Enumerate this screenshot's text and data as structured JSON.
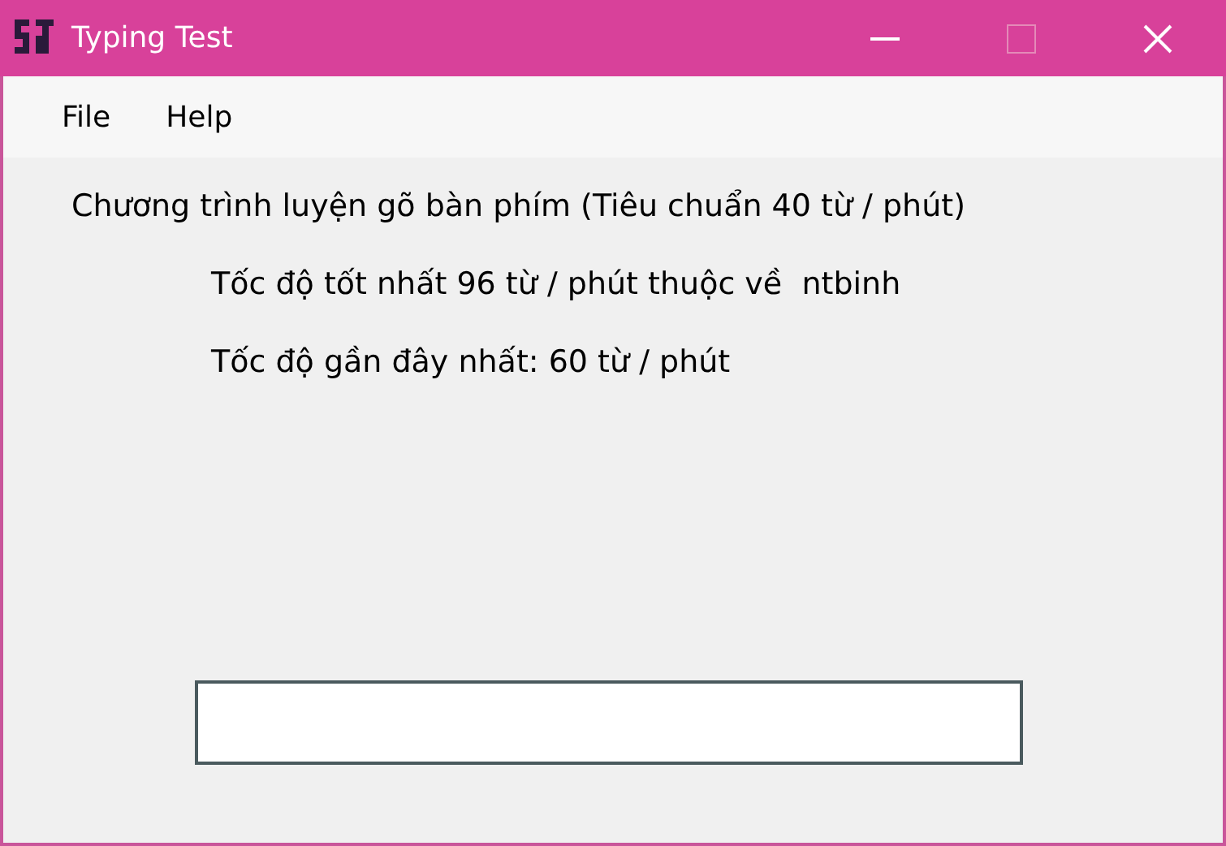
{
  "window": {
    "title": "Typing Test",
    "controls": [
      {
        "kind": "minimize",
        "disabled": false
      },
      {
        "kind": "maximize",
        "disabled": true
      },
      {
        "kind": "close",
        "disabled": false
      }
    ]
  },
  "menu": [
    "File",
    "Help"
  ],
  "heading": "Chương trình luyện gõ bàn phím (Tiêu chuẩn 40 từ / phút)",
  "stats": [
    "Tốc độ tốt nhất 96 từ / phút thuộc về  ntbinh",
    "Tốc độ gần đây nhất: 60 từ / phút"
  ]
}
